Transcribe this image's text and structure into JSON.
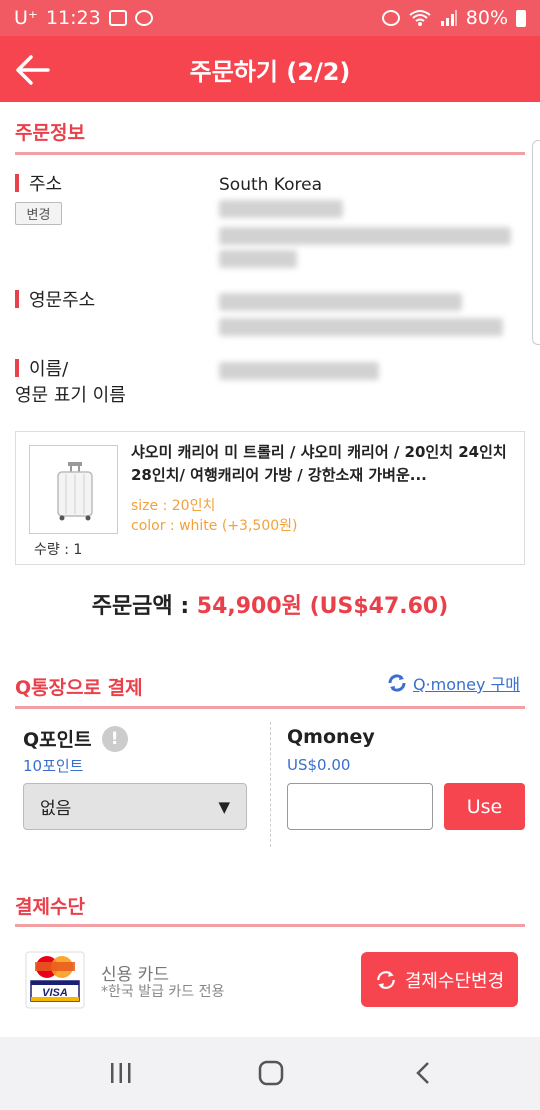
{
  "status_bar": {
    "carrier": "U⁺",
    "time": "11:23",
    "battery": "80%"
  },
  "header": {
    "title": "주문하기 (2/2)"
  },
  "order_info": {
    "section_title": "주문정보",
    "address_label": "주소",
    "address_change_button": "변경",
    "address_country": "South Korea",
    "english_address_label": "영문주소",
    "name_label_line1": "이름/",
    "name_label_line2": "영문 표기 이름"
  },
  "product": {
    "name": "샤오미 캐리어 미 트롤리 / 샤오미 캐리어 / 20인치 24인치 28인치/ 여행캐리어 가방 / 강한소재 가벼운...",
    "size": "size : 20인치",
    "color": "color : white (+3,500원)",
    "quantity": "수량 : 1"
  },
  "total": {
    "label": "주문금액 : ",
    "price": "54,900원 (US$47.60)"
  },
  "qpay": {
    "section_title": "Q통장으로 결제",
    "qmoney_purchase_link": "Q·money 구매",
    "qpoint_title": "Q포인트",
    "qpoint_balance": "10포인트",
    "qpoint_select_value": "없음",
    "qmoney_title": "Qmoney",
    "qmoney_balance": "US$0.00",
    "use_button": "Use"
  },
  "payment": {
    "section_title": "결제수단",
    "card_name": "신용 카드",
    "card_note": "*한국 발급 카드 전용",
    "change_button": "결제수단변경"
  },
  "colors": {
    "accent": "#f7454f",
    "status_bar": "#f25a63",
    "link": "#3a6fd0",
    "option_text": "#f2a23a"
  }
}
